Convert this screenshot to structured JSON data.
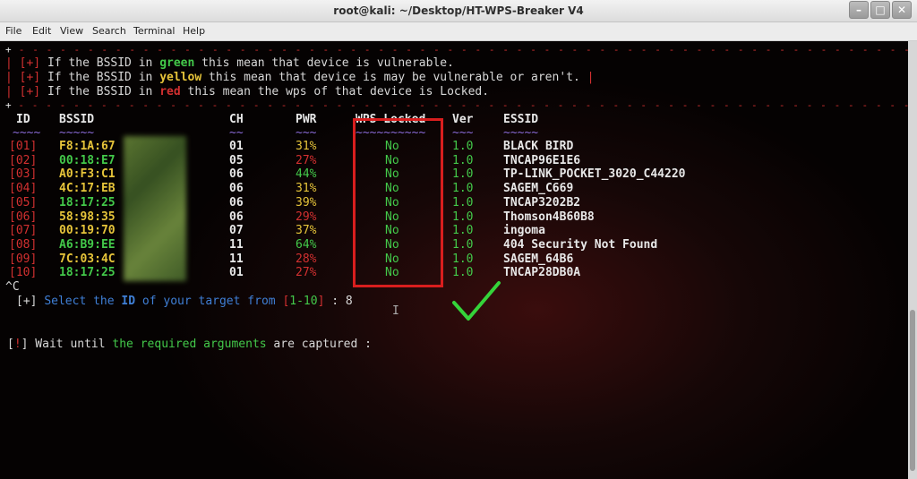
{
  "window": {
    "title": "root@kali: ~/Desktop/HT-WPS-Breaker V4"
  },
  "menu": [
    "File",
    "Edit",
    "View",
    "Search",
    "Terminal",
    "Help"
  ],
  "legend": {
    "border_top": "+ - - - - - - - - - - - - - - - - - - - - - - - - - - - - - - - - - - - - - - - - - - - - - - - - - - - - - - - - - - - - - - - - - - - - - - - - - - - - - - - - - - - - - - - - +",
    "tag": "[+]",
    "line1_a": "If the BSSID in ",
    "line1_word": "green",
    "line1_b": " this mean that device is vulnerable.",
    "line2_a": "If the BSSID in ",
    "line2_word": "yellow",
    "line2_b": " this mean that device is may be vulnerable or aren't.",
    "line3_a": "If the BSSID in ",
    "line3_word": "red",
    "line3_b": " this mean the wps of that device is Locked."
  },
  "table": {
    "headers": {
      "id": "ID",
      "bssid": "BSSID",
      "ch": "CH",
      "pwr": "PWR",
      "wps": "WPS Locked",
      "ver": "Ver",
      "essid": "ESSID"
    },
    "underline": {
      "id": "~~~~",
      "bssid": "~~~~~",
      "ch": "~~",
      "pwr": "~~~",
      "wps": "~~~~~~~~~~",
      "ver": "~~~",
      "essid": "~~~~~"
    },
    "rows": [
      {
        "id": "[01]",
        "bssid": "F8:1A:67",
        "ch": "01",
        "pwr": "31%",
        "wps": "No",
        "ver": "1.0",
        "essid": "BLACK BIRD"
      },
      {
        "id": "[02]",
        "bssid": "00:18:E7",
        "ch": "05",
        "pwr": "27%",
        "wps": "No",
        "ver": "1.0",
        "essid": "TNCAP96E1E6"
      },
      {
        "id": "[03]",
        "bssid": "A0:F3:C1",
        "ch": "06",
        "pwr": "44%",
        "wps": "No",
        "ver": "1.0",
        "essid": "TP-LINK_POCKET_3020_C44220"
      },
      {
        "id": "[04]",
        "bssid": "4C:17:EB",
        "ch": "06",
        "pwr": "31%",
        "wps": "No",
        "ver": "1.0",
        "essid": "SAGEM_C669"
      },
      {
        "id": "[05]",
        "bssid": "18:17:25",
        "ch": "06",
        "pwr": "39%",
        "wps": "No",
        "ver": "1.0",
        "essid": "TNCAP3202B2"
      },
      {
        "id": "[06]",
        "bssid": "58:98:35",
        "ch": "06",
        "pwr": "29%",
        "wps": "No",
        "ver": "1.0",
        "essid": "Thomson4B60B8"
      },
      {
        "id": "[07]",
        "bssid": "00:19:70",
        "ch": "07",
        "pwr": "37%",
        "wps": "No",
        "ver": "1.0",
        "essid": "ingoma"
      },
      {
        "id": "[08]",
        "bssid": "A6:B9:EE",
        "ch": "11",
        "pwr": "64%",
        "wps": "No",
        "ver": "1.0",
        "essid": "404 Security Not Found"
      },
      {
        "id": "[09]",
        "bssid": "7C:03:4C",
        "ch": "11",
        "pwr": "28%",
        "wps": "No",
        "ver": "1.0",
        "essid": "SAGEM_64B6"
      },
      {
        "id": "[10]",
        "bssid": "18:17:25",
        "ch": "01",
        "pwr": "27%",
        "wps": "No",
        "ver": "1.0",
        "essid": "TNCAP28DB0A"
      }
    ]
  },
  "interrupt": "^C",
  "prompt": {
    "tag": "[+]",
    "a": "Select the ",
    "b": "ID",
    "c": " of your target from ",
    "d": "[",
    "range": "1-10",
    "e": "]",
    "f": " : ",
    "value": "8"
  },
  "wait": {
    "tag_open": "[",
    "tag_mid": "!",
    "tag_close": "]",
    "a": " Wait until ",
    "b": "the required arguments",
    "c": " are captured :"
  },
  "colors": {
    "red": "#d23030",
    "green": "#43c94a",
    "yellow": "#e6c43a",
    "accent_box": "#d81e1e"
  }
}
